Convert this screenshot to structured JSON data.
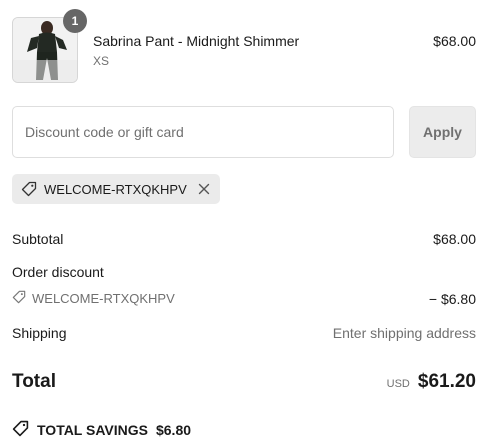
{
  "product": {
    "quantity": "1",
    "name": "Sabrina Pant - Midnight Shimmer",
    "variant": "XS",
    "price": "$68.00"
  },
  "discount": {
    "placeholder": "Discount code or gift card",
    "value": "",
    "apply_label": "Apply"
  },
  "applied_code": {
    "code": "WELCOME-RTXQKHPV"
  },
  "summary": {
    "subtotal_label": "Subtotal",
    "subtotal_value": "$68.00",
    "order_discount_label": "Order discount",
    "discount_code": "WELCOME-RTXQKHPV",
    "discount_value": "− $6.80",
    "shipping_label": "Shipping",
    "shipping_value": "Enter shipping address",
    "total_label": "Total",
    "currency": "USD",
    "total_value": "$61.20",
    "savings_label": "TOTAL SAVINGS",
    "savings_value": "$6.80"
  },
  "icons": {
    "tag": "tag-icon",
    "close": "close-icon"
  }
}
